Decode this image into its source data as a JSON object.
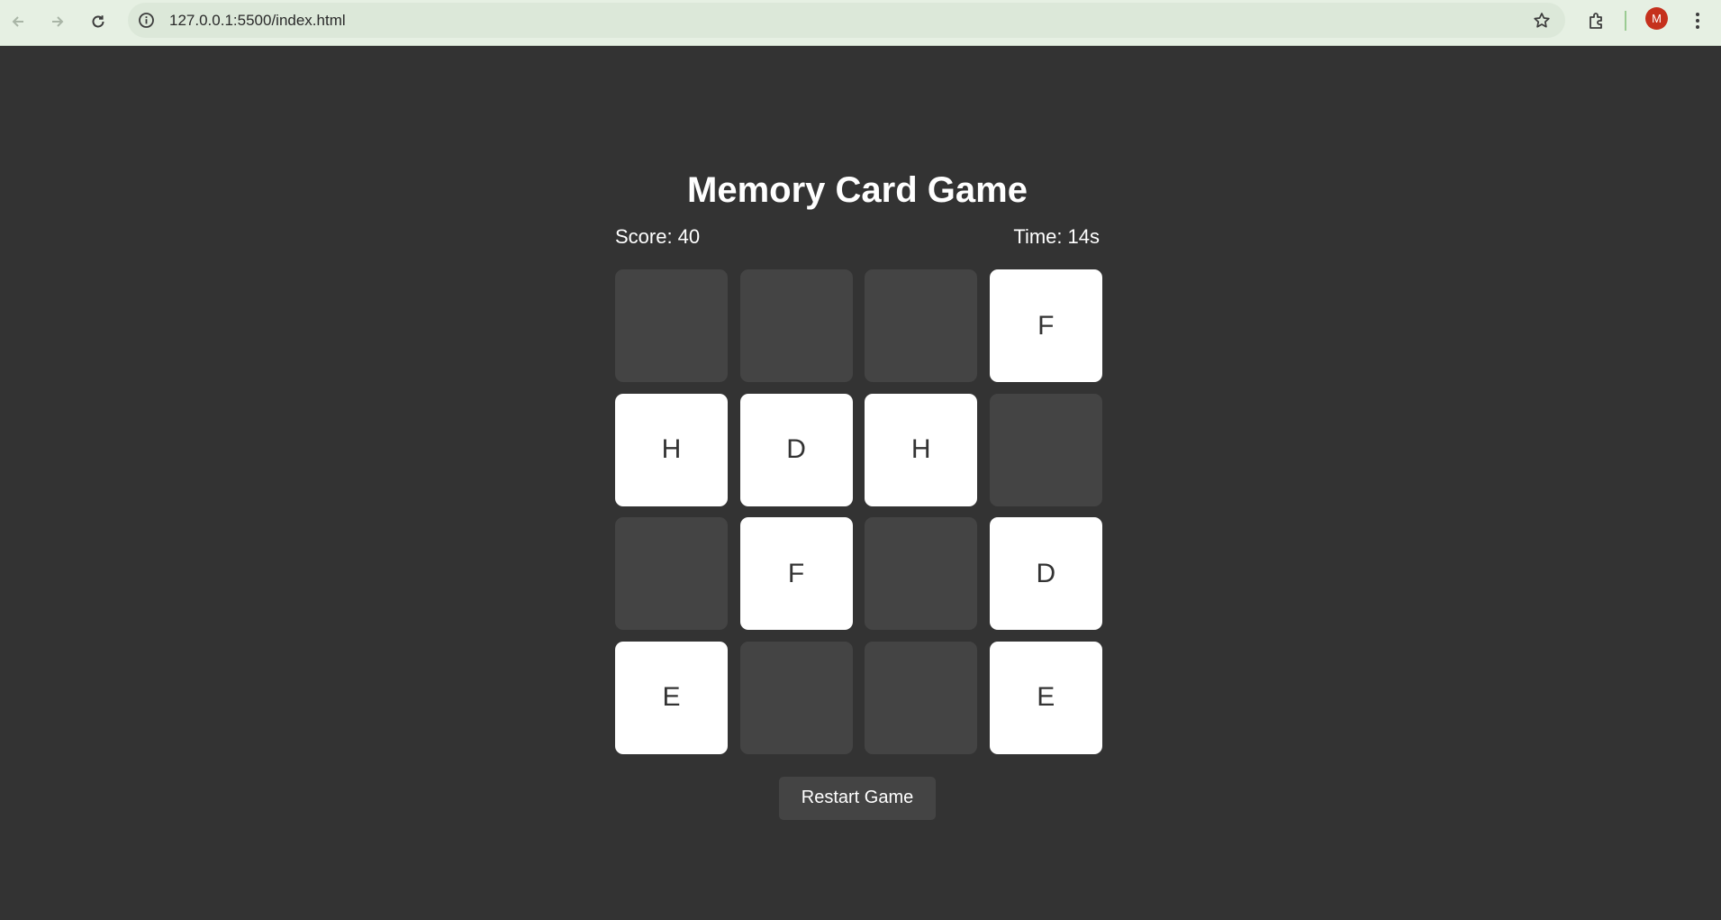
{
  "browser": {
    "url": "127.0.0.1:5500/index.html",
    "avatar_letter": "M",
    "avatar_color": "#c5311d",
    "chrome_color": "#e6f0e3"
  },
  "game": {
    "title": "Memory Card Game",
    "score_label": "Score:",
    "score_value": "40",
    "time_label": "Time:",
    "time_value": "14s",
    "restart_label": "Restart Game",
    "background_color": "#333333",
    "card_back_color": "#444444",
    "card_face_color": "#ffffff",
    "cards": [
      {
        "flipped": false,
        "letter": ""
      },
      {
        "flipped": false,
        "letter": ""
      },
      {
        "flipped": false,
        "letter": ""
      },
      {
        "flipped": true,
        "letter": "F"
      },
      {
        "flipped": true,
        "letter": "H"
      },
      {
        "flipped": true,
        "letter": "D"
      },
      {
        "flipped": true,
        "letter": "H"
      },
      {
        "flipped": false,
        "letter": ""
      },
      {
        "flipped": false,
        "letter": ""
      },
      {
        "flipped": true,
        "letter": "F"
      },
      {
        "flipped": false,
        "letter": ""
      },
      {
        "flipped": true,
        "letter": "D"
      },
      {
        "flipped": true,
        "letter": "E"
      },
      {
        "flipped": false,
        "letter": ""
      },
      {
        "flipped": false,
        "letter": ""
      },
      {
        "flipped": true,
        "letter": "E"
      }
    ]
  }
}
